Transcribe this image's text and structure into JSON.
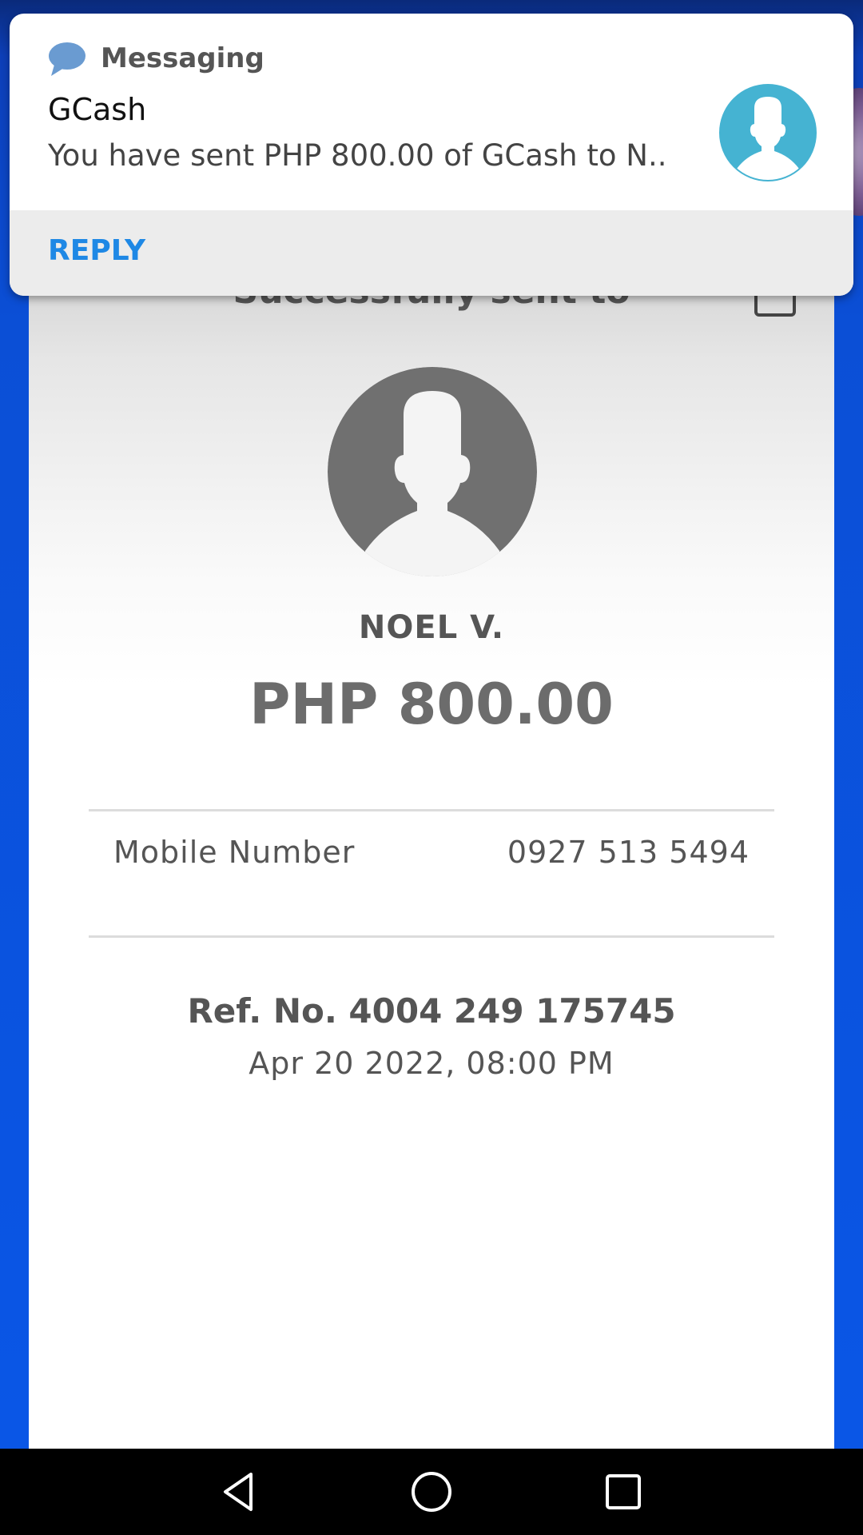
{
  "notification": {
    "app_name": "Messaging",
    "app_icon": "chat-bubble-icon",
    "title": "GCash",
    "text": "You have sent PHP 800.00 of GCash to N..",
    "avatar_icon": "person-avatar-icon",
    "reply_label": "REPLY",
    "reply_color": "#1e88e5"
  },
  "receipt": {
    "heading": "Successfully sent to",
    "download_icon": "download-icon",
    "recipient_name": "NOEL V.",
    "amount": "PHP 800.00",
    "details": [
      {
        "label": "Mobile Number",
        "value": "0927 513 5494"
      }
    ],
    "reference": "Ref. No. 4004 249 175745",
    "datetime": "Apr 20 2022, 08:00 PM"
  },
  "navbar": {
    "back_icon": "back-triangle-icon",
    "home_icon": "home-circle-icon",
    "recents_icon": "recents-square-icon"
  },
  "colors": {
    "background_blue": "#0b4fd6",
    "avatar_teal": "#45b3d2",
    "avatar_grey": "#707070"
  }
}
